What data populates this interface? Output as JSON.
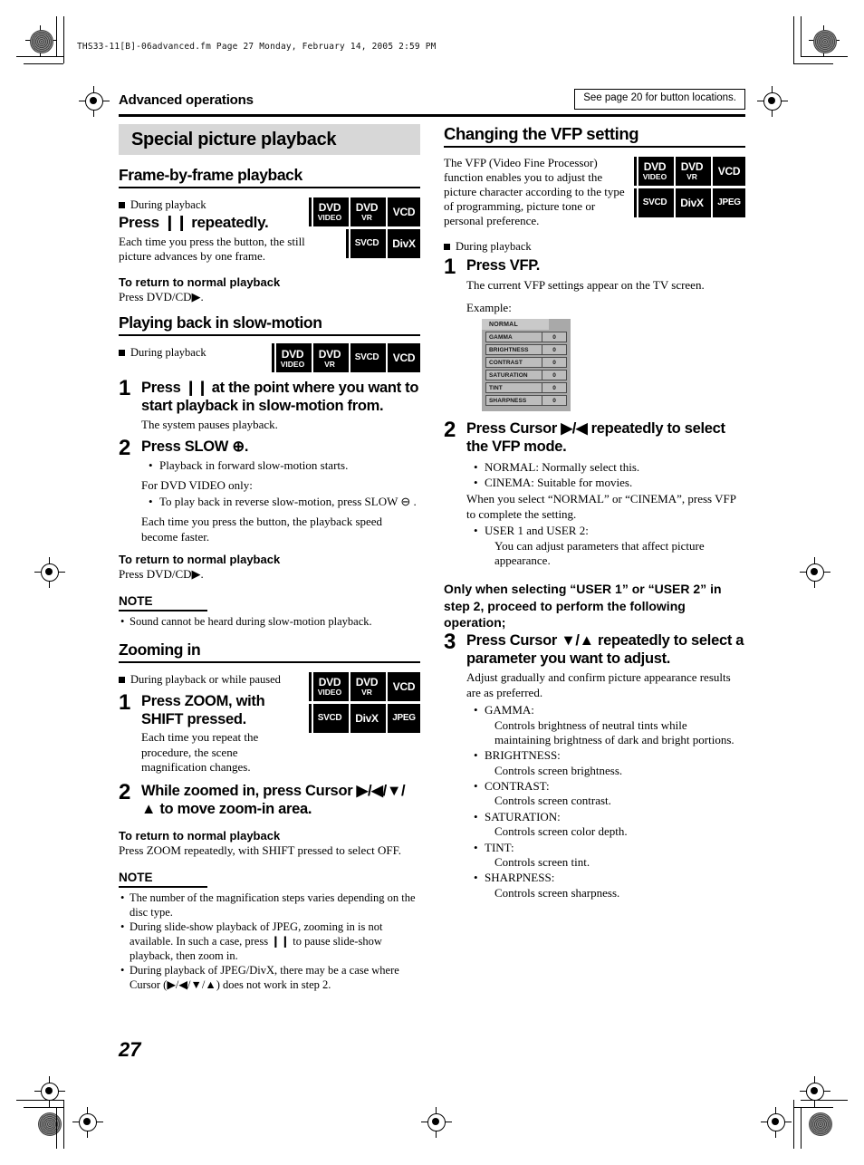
{
  "slug": "THS33-11[B]-06advanced.fm  Page 27  Monday, February 14, 2005  2:59 PM",
  "header": {
    "running_head": "Advanced operations",
    "button_note": "See page 20 for button locations."
  },
  "banner": {
    "title": "Special picture playback"
  },
  "page_number": "27",
  "left_column": {
    "frame_by_frame": {
      "heading": "Frame-by-frame playback",
      "condition": "During playback",
      "instruction_pre": "Press",
      "instruction_sym": "❙❙",
      "instruction_post": "repeatedly.",
      "body": "Each time you press the button, the still picture advances by one frame.",
      "return_head": "To return to normal playback",
      "return_body": "Press DVD/CD▶.",
      "badges": [
        [
          {
            "l1": "DVD",
            "l2": "VIDEO"
          },
          {
            "l1": "DVD",
            "l2": "VR"
          },
          {
            "l1": "VCD",
            "l2": ""
          }
        ],
        [
          {
            "blank": true
          },
          {
            "l1": "SVCD",
            "l2": ""
          },
          {
            "l1": "DivX",
            "l2": ""
          }
        ]
      ]
    },
    "slow_motion": {
      "heading": "Playing back in slow-motion",
      "condition": "During playback",
      "badges": [
        [
          {
            "l1": "DVD",
            "l2": "VIDEO"
          },
          {
            "l1": "DVD",
            "l2": "VR"
          },
          {
            "l1": "SVCD",
            "l2": ""
          },
          {
            "l1": "VCD",
            "l2": ""
          }
        ]
      ],
      "step1_num": "1",
      "step1_title_a": "Press",
      "step1_sym": "❙❙",
      "step1_title_b": "at the point where you want to start playback in slow-motion from.",
      "step1_sub": "The system pauses playback.",
      "step2_num": "2",
      "step2_title": "Press SLOW ⊕.",
      "step2_bullet": "Playback in forward slow-motion starts.",
      "step2_note_head": "For DVD VIDEO only:",
      "step2_note_bullet": "To play back in reverse slow-motion, press SLOW ⊖ .",
      "step2_tail": "Each time you press the button, the playback speed become faster.",
      "return_head": "To return to normal playback",
      "return_body": "Press DVD/CD▶.",
      "note_head": "NOTE",
      "notes": [
        "Sound cannot be heard during slow-motion playback."
      ]
    },
    "zooming": {
      "heading": "Zooming in",
      "condition": "During playback or while paused",
      "badges": [
        [
          {
            "l1": "DVD",
            "l2": "VIDEO"
          },
          {
            "l1": "DVD",
            "l2": "VR"
          },
          {
            "l1": "VCD",
            "l2": ""
          }
        ],
        [
          {
            "l1": "SVCD",
            "l2": ""
          },
          {
            "l1": "DivX",
            "l2": ""
          },
          {
            "l1": "JPEG",
            "l2": ""
          }
        ]
      ],
      "step1_num": "1",
      "step1_title": "Press ZOOM, with SHIFT pressed.",
      "step1_sub": "Each time you repeat the procedure, the scene magnification changes.",
      "step2_num": "2",
      "step2_title": "While zoomed in, press Cursor ▶/◀/▼/ ▲ to move zoom-in area.",
      "return_head": "To return to normal playback",
      "return_body": "Press ZOOM repeatedly, with SHIFT pressed to select OFF.",
      "note_head": "NOTE",
      "notes": [
        "The number of the magnification steps varies depending on the disc type.",
        "During slide-show playback of JPEG, zooming in is not available. In such a case, press ❙❙ to pause slide-show playback, then zoom in.",
        "During playback of JPEG/DivX, there may be a case where Cursor (▶/◀/▼/▲) does not work in step 2."
      ]
    }
  },
  "right_column": {
    "vfp": {
      "heading": "Changing the VFP setting",
      "intro": "The VFP (Video Fine Processor) function enables you to adjust the picture character according to the type of programming, picture tone or personal preference.",
      "badges": [
        [
          {
            "l1": "DVD",
            "l2": "VIDEO"
          },
          {
            "l1": "DVD",
            "l2": "VR"
          },
          {
            "l1": "VCD",
            "l2": ""
          }
        ],
        [
          {
            "l1": "SVCD",
            "l2": ""
          },
          {
            "l1": "DivX",
            "l2": ""
          },
          {
            "l1": "JPEG",
            "l2": ""
          }
        ]
      ],
      "condition": "During playback",
      "step1_num": "1",
      "step1_title": "Press VFP.",
      "step1_sub": "The current VFP settings appear on the TV screen.",
      "example_label": "Example:",
      "osd": {
        "mode": "NORMAL",
        "rows": [
          {
            "name": "GAMMA",
            "value": "0"
          },
          {
            "name": "BRIGHTNESS",
            "value": "0"
          },
          {
            "name": "CONTRAST",
            "value": "0"
          },
          {
            "name": "SATURATION",
            "value": "0"
          },
          {
            "name": "TINT",
            "value": "0"
          },
          {
            "name": "SHARPNESS",
            "value": "0"
          }
        ]
      },
      "step2_num": "2",
      "step2_title": "Press Cursor ▶/◀ repeatedly to select the VFP mode.",
      "step2_bullets": [
        "NORMAL: Normally select this.",
        "CINEMA:  Suitable for movies."
      ],
      "step2_mid": "When you select “NORMAL” or “CINEMA”, press VFP to complete the setting.",
      "step2_bullet3": "USER 1 and USER 2:",
      "step2_bullet3_sub": "You can adjust parameters that affect picture appearance.",
      "bold_lead": "Only when selecting “USER 1” or “USER 2” in step 2, proceed to perform the following operation;",
      "step3_num": "3",
      "step3_title": "Press Cursor ▼/▲ repeatedly to select a parameter you want to adjust.",
      "step3_sub": "Adjust gradually and confirm picture appearance results are as preferred.",
      "parameters": [
        {
          "name": "GAMMA:",
          "desc": "Controls brightness of neutral tints while maintaining brightness of dark and bright portions."
        },
        {
          "name": "BRIGHTNESS:",
          "desc": "Controls screen brightness."
        },
        {
          "name": "CONTRAST:",
          "desc": "Controls screen contrast."
        },
        {
          "name": "SATURATION:",
          "desc": "Controls screen color depth."
        },
        {
          "name": "TINT:",
          "desc": "Controls screen tint."
        },
        {
          "name": "SHARPNESS:",
          "desc": "Controls screen sharpness."
        }
      ]
    }
  }
}
